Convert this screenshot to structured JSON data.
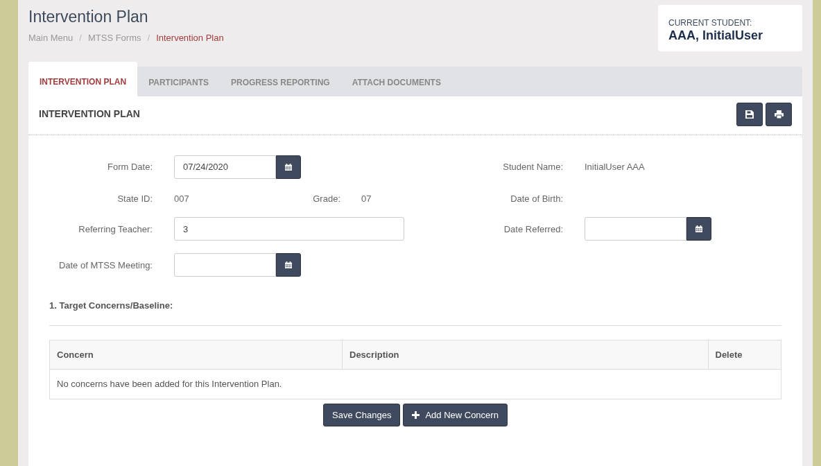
{
  "page": {
    "title": "Intervention Plan"
  },
  "breadcrumb": [
    {
      "label": "Main Menu",
      "selected": false
    },
    {
      "separator": "/",
      "label": "MTSS Forms",
      "selected": false
    },
    {
      "separator": "/",
      "label": "Intervention Plan",
      "selected": true
    }
  ],
  "current_student": {
    "label": "CURRENT STUDENT:",
    "name": "AAA, InitialUser"
  },
  "tabs": [
    {
      "label": "INTERVENTION PLAN",
      "selected": true
    },
    {
      "label": "PARTICIPANTS",
      "selected": false
    },
    {
      "label": "PROGRESS REPORTING",
      "selected": false
    },
    {
      "label": "ATTACH DOCUMENTS",
      "selected": false
    }
  ],
  "panel": {
    "title": "INTERVENTION PLAN"
  },
  "form": {
    "form_date": {
      "label": "Form Date:",
      "value": "07/24/2020"
    },
    "student_name": {
      "label": "Student Name:",
      "value": "InitialUser AAA"
    },
    "state_id": {
      "label": "State ID:",
      "value": "007"
    },
    "grade": {
      "label": "Grade:",
      "value": "07"
    },
    "date_of_birth": {
      "label": "Date of Birth:"
    },
    "referring_teacher": {
      "label": "Referring Teacher:",
      "value": "3"
    },
    "date_referred": {
      "label": "Date Referred:"
    },
    "meeting_date": {
      "label": "Date of MTSS Meeting:"
    }
  },
  "section": {
    "title": "1. Target Concerns/Baseline:"
  },
  "table": {
    "columns": [
      "Concern",
      "Description",
      "Delete"
    ],
    "empty_message": "No concerns have been added for this Intervention Plan."
  },
  "buttons": [
    {
      "label": "Save Changes",
      "kind": "plain"
    },
    {
      "label": "Add New Concern",
      "kind": "add"
    }
  ]
}
